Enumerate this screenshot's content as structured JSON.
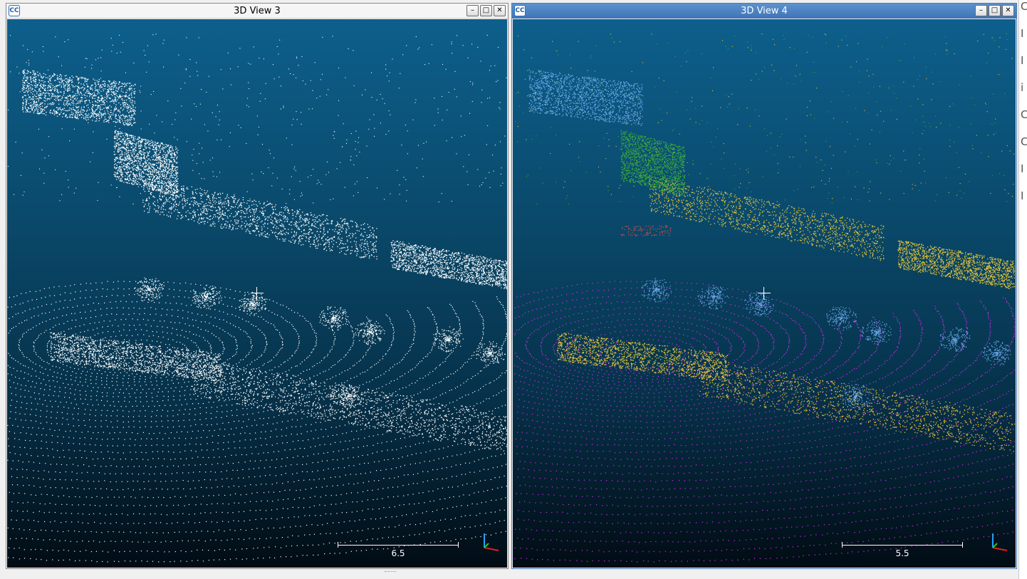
{
  "left_view": {
    "title": "3D View 3",
    "app_icon": "cloudcompare-logo-icon",
    "scale_label": "6.5",
    "buttons": {
      "minimize": "–",
      "maximize": "□",
      "close": "✕"
    }
  },
  "right_view": {
    "title": "3D View 4",
    "app_icon": "cloudcompare-logo-icon",
    "scale_label": "5.5",
    "buttons": {
      "minimize": "–",
      "maximize": "□",
      "close": "✕"
    }
  },
  "colors": {
    "background_top": "#0d5f8c",
    "background_bottom": "#010c14",
    "points_plain": "#ffffff",
    "class_ground": "#d92ef0",
    "class_building": "#e8c63a",
    "class_vegetation": "#3aa83a",
    "class_vehicle": "#6aa8e8",
    "class_other": "#c05050",
    "active_titlebar": "#4a82c4"
  }
}
